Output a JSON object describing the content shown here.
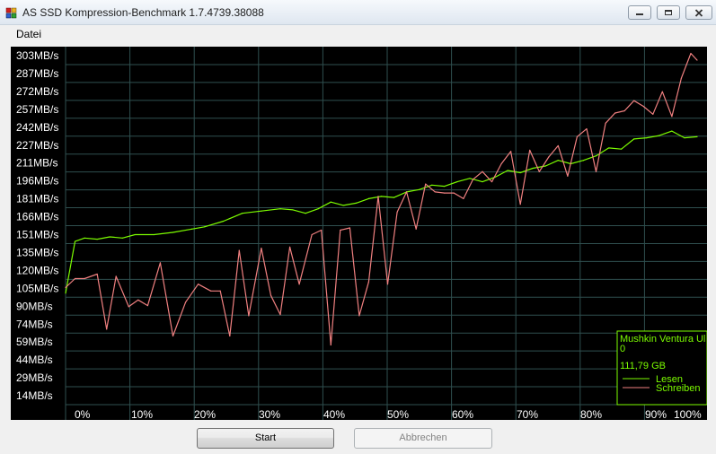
{
  "window": {
    "title": "AS SSD Kompression-Benchmark 1.7.4739.38088"
  },
  "menu": {
    "items": [
      {
        "label": "Datei"
      }
    ]
  },
  "buttons": {
    "start_label": "Start",
    "abbrechen_label": "Abbrechen",
    "abbrechen_enabled": false
  },
  "legend": {
    "drive_line1": "Mushkin Ventura Ul",
    "drive_line2": "0",
    "capacity": "111,79 GB",
    "read_label": "Lesen",
    "write_label": "Schreiben"
  },
  "colors": {
    "background": "#000000",
    "grid": "#2f4f4f",
    "read": "#7cfc00",
    "write": "#f08080",
    "axis_text": "#ffffff"
  },
  "chart_data": {
    "type": "line",
    "xlabel": "",
    "ylabel": "",
    "x_ticks": [
      "0%",
      "10%",
      "20%",
      "30%",
      "40%",
      "50%",
      "60%",
      "70%",
      "80%",
      "90%",
      "100%"
    ],
    "y_ticks": [
      "303MB/s",
      "287MB/s",
      "272MB/s",
      "257MB/s",
      "242MB/s",
      "227MB/s",
      "211MB/s",
      "196MB/s",
      "181MB/s",
      "166MB/s",
      "151MB/s",
      "135MB/s",
      "120MB/s",
      "105MB/s",
      "90MB/s",
      "74MB/s",
      "59MB/s",
      "44MB/s",
      "29MB/s",
      "14MB/s"
    ],
    "ylim": [
      0,
      318
    ],
    "xlim": [
      0,
      100
    ],
    "grid": true,
    "legend_position": "bottom-right",
    "series": [
      {
        "name": "Lesen",
        "color": "#7cfc00",
        "x": [
          0,
          1.5,
          3,
          5,
          7,
          9,
          11,
          14,
          17,
          20,
          22,
          25,
          28,
          31,
          34,
          36,
          38,
          40,
          42,
          44,
          46,
          48,
          50,
          52,
          54,
          56,
          58,
          60,
          62,
          64,
          66,
          68,
          70,
          72,
          74,
          76,
          78,
          80,
          82,
          84,
          86,
          88,
          90,
          92,
          94,
          96,
          98,
          100
        ],
        "y": [
          99,
          145,
          148,
          147,
          149,
          148,
          151,
          151,
          153,
          156,
          158,
          163,
          170,
          172,
          174,
          173,
          170,
          174,
          180,
          177,
          179,
          183,
          185,
          184,
          189,
          191,
          195,
          194,
          198,
          201,
          198,
          202,
          208,
          206,
          210,
          212,
          217,
          214,
          217,
          221,
          228,
          227,
          236,
          237,
          239,
          243,
          237,
          238
        ]
      },
      {
        "name": "Schreiben",
        "color": "#f08080",
        "x": [
          0,
          1.5,
          3,
          5,
          6.5,
          8,
          10,
          11.5,
          13,
          15,
          17,
          19,
          21,
          23,
          24.5,
          26,
          27.5,
          29,
          31,
          32.5,
          34,
          35.5,
          37,
          39,
          40.5,
          42,
          43.5,
          45,
          46.5,
          48,
          49.5,
          51,
          52.5,
          54,
          55.5,
          57,
          58.5,
          60,
          61.5,
          63,
          64.5,
          66,
          67.5,
          69,
          70.5,
          72,
          73.5,
          75,
          76.5,
          78,
          79.5,
          81,
          82.5,
          84,
          85.5,
          87,
          88.5,
          90,
          91.5,
          93,
          94.5,
          96,
          97.5,
          99,
          100
        ],
        "y": [
          104,
          112,
          112,
          116,
          67,
          114,
          87,
          93,
          88,
          126,
          61,
          91,
          107,
          101,
          101,
          61,
          137,
          79,
          139,
          97,
          80,
          140,
          107,
          151,
          155,
          53,
          155,
          157,
          79,
          109,
          185,
          107,
          171,
          189,
          156,
          196,
          189,
          188,
          188,
          183,
          200,
          207,
          198,
          214,
          225,
          178,
          226,
          207,
          220,
          230,
          203,
          238,
          245,
          207,
          250,
          259,
          261,
          270,
          265,
          258,
          278,
          256,
          290,
          312,
          306
        ]
      }
    ]
  }
}
